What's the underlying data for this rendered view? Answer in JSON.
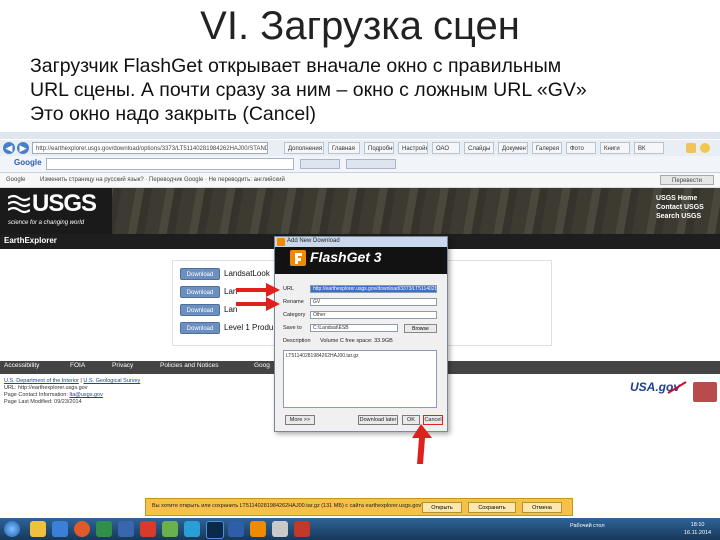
{
  "slide": {
    "title": "VI. Загрузка сцен",
    "lines": [
      "Загрузчик FlashGet открывает вначале окно с правильным",
      "URL сцены. А почти сразу за ним – окно с ложным URL «GV»",
      "Это окно надо закрыть (Cancel)"
    ]
  },
  "browser": {
    "address": "http://earthexplorer.usgs.gov/download/options/3373/LT51140281984262HAJ00/STANDARD",
    "tabs": [
      "Дополнения",
      "Главная",
      "Подробнее",
      "Настройка",
      "ОАО",
      "Слайды",
      "Документы",
      "Галерея",
      "Фото",
      "Книги",
      "ВК"
    ],
    "google_logo": "Google",
    "translate_text": "Изменить страницу на русский язык? · Переводчик Google · Не переводить: английский",
    "translate_button": "Перевести"
  },
  "usgs": {
    "logo": "USGS",
    "tagline": "science for a changing world",
    "links": [
      "USGS Home",
      "Contact USGS",
      "Search USGS"
    ],
    "app_name": "EarthExplorer"
  },
  "downloads": [
    {
      "button": "Download",
      "label": "LandsatLook"
    },
    {
      "button": "Download",
      "label": "Lan"
    },
    {
      "button": "Download",
      "label": "Lan"
    },
    {
      "button": "Download",
      "label": "Level 1 Produ"
    }
  ],
  "footer": {
    "nav": [
      "Accessibility",
      "FOIA",
      "Privacy",
      "Policies and Notices",
      "Goog"
    ],
    "lines": [
      {
        "pre": "",
        "link1": "U.S. Department of the Interior",
        "mid": " | ",
        "link2": "U.S. Geological Survey"
      },
      {
        "pre": "URL: http://earthexplorer.usgs.gov",
        "link1": "",
        "mid": "",
        "link2": ""
      },
      {
        "pre": "Page Contact Information: ",
        "link1": "lta@usgs.gov",
        "mid": "",
        "link2": ""
      },
      {
        "pre": "Page Last Modified: 09/23/2014",
        "link1": "",
        "mid": "",
        "link2": ""
      }
    ],
    "usa_gov": "USA.gov"
  },
  "flashget": {
    "window_title": "Add New Download",
    "logo": "FlashGet 3",
    "labels": {
      "url": "URL",
      "rename": "Rename",
      "category": "Category",
      "save_to": "Save to",
      "description": "Description"
    },
    "url_value": "http://earthexplorer.usgs.gov/download/3373/LT51140281984262HAJ00",
    "rename_value": "GV",
    "category_value": "Other",
    "save_to_value": "C:\\Landsat\\ESB",
    "browse": "Browse",
    "free_space": "Volume C free space: 33.9GB",
    "description_value": "LT51140281984262HAJ00.tar.gz",
    "buttons": {
      "more": "More >>",
      "download_later": "Download later",
      "ok": "OK",
      "cancel": "Cancel"
    }
  },
  "download_bar": {
    "text": "Вы хотите открыть или сохранить LT51140281984262HAJ00.tar.gz (131 МБ) с сайта earthexplorer.usgs.gov?",
    "buttons": [
      "Открыть",
      "Сохранить",
      "Отмена"
    ]
  },
  "taskbar": {
    "tray_text": "Рабочий стол",
    "time": "18:10",
    "date": "16.11.2014"
  },
  "colors": {
    "arrow_red": "#e0201c",
    "usgs_dark": "#1a1a1a",
    "download_bar": "#f6c04a"
  }
}
